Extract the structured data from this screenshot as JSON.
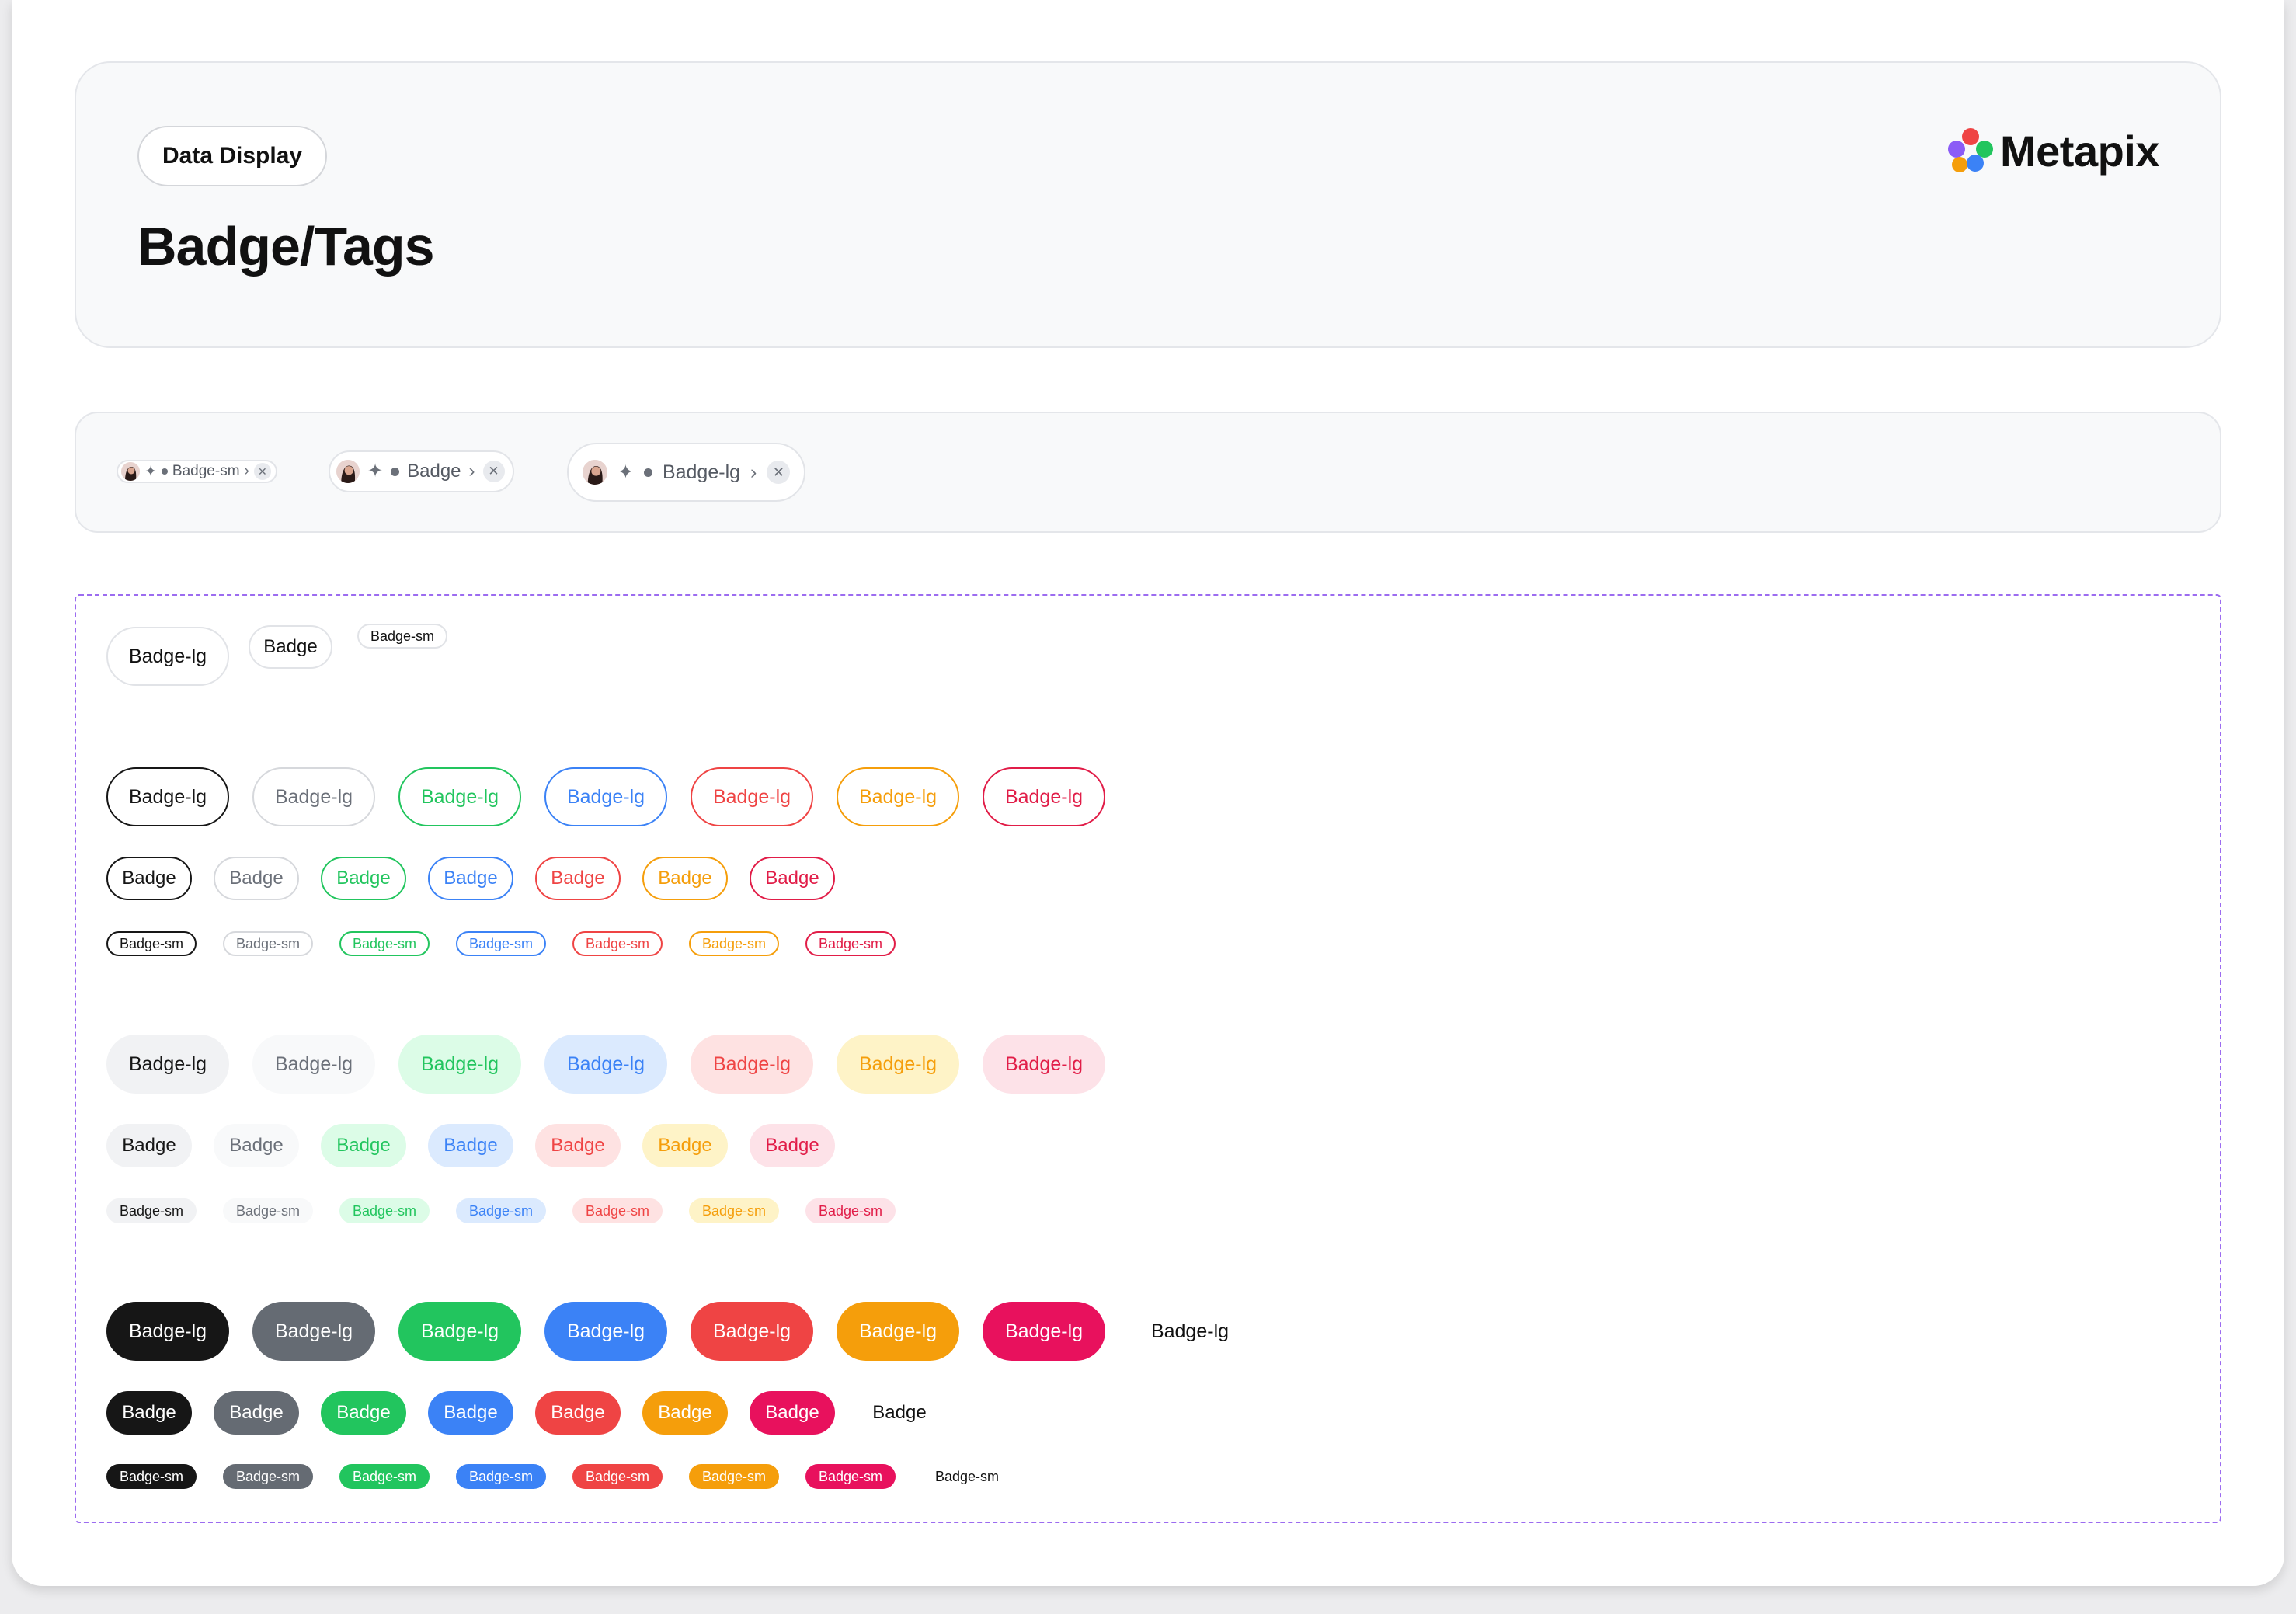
{
  "header": {
    "category": "Data Display",
    "title": "Badge/Tags",
    "brand": "Metapix",
    "logo_colors": [
      "#ef4444",
      "#8b5cf6",
      "#22c55e",
      "#3b82f6",
      "#f59e0b"
    ]
  },
  "preview_tags": [
    {
      "size": "sm",
      "label": "Badge-sm",
      "icons": [
        "avatar",
        "sparkle-icon",
        "dot-icon",
        "chevron-right-icon",
        "close-icon"
      ]
    },
    {
      "size": "md",
      "label": "Badge",
      "icons": [
        "avatar",
        "sparkle-icon",
        "dot-icon",
        "chevron-right-icon",
        "close-icon"
      ]
    },
    {
      "size": "lg",
      "label": "Badge-lg",
      "icons": [
        "avatar",
        "sparkle-icon",
        "dot-icon",
        "chevron-right-icon",
        "close-icon"
      ]
    }
  ],
  "basic_badges": [
    {
      "size": "lg",
      "label": "Badge-lg"
    },
    {
      "size": "md",
      "label": "Badge"
    },
    {
      "size": "sm",
      "label": "Badge-sm"
    }
  ],
  "palette": [
    {
      "name": "black",
      "main": "#161616",
      "text": "#161616",
      "border": "#161616",
      "light_bg": "#f1f2f4",
      "light_text": "#161616"
    },
    {
      "name": "gray",
      "main": "#656b73",
      "text": "#6b7079",
      "border": "#d6d8dc",
      "light_bg": "#f8f9fa",
      "light_text": "#6b7079"
    },
    {
      "name": "green",
      "main": "#22c55e",
      "text": "#22c55e",
      "border": "#22c55e",
      "light_bg": "#dcfce7",
      "light_text": "#22c55e"
    },
    {
      "name": "blue",
      "main": "#3b82f6",
      "text": "#3b82f6",
      "border": "#3b82f6",
      "light_bg": "#dbeafe",
      "light_text": "#3b82f6"
    },
    {
      "name": "red",
      "main": "#ef4444",
      "text": "#ef4444",
      "border": "#ef4444",
      "light_bg": "#fee2e2",
      "light_text": "#ef4444"
    },
    {
      "name": "amber",
      "main": "#f59e0b",
      "text": "#f59e0b",
      "border": "#f59e0b",
      "light_bg": "#fef3c7",
      "light_text": "#f59e0b"
    },
    {
      "name": "pink",
      "main": "#e8115d",
      "text": "#e11d48",
      "border": "#e11d48",
      "light_bg": "#fde2e8",
      "light_text": "#e11d48"
    }
  ],
  "variant_groups": [
    {
      "variant": "outline",
      "rows": [
        {
          "size": "lg",
          "label": "Badge-lg"
        },
        {
          "size": "md",
          "label": "Badge"
        },
        {
          "size": "sm",
          "label": "Badge-sm"
        }
      ]
    },
    {
      "variant": "soft",
      "rows": [
        {
          "size": "lg",
          "label": "Badge-lg"
        },
        {
          "size": "md",
          "label": "Badge"
        },
        {
          "size": "sm",
          "label": "Badge-sm"
        }
      ]
    },
    {
      "variant": "solid",
      "rows": [
        {
          "size": "lg",
          "label": "Badge-lg",
          "extra_plain_label": "Badge-lg"
        },
        {
          "size": "md",
          "label": "Badge",
          "extra_plain_label": "Badge"
        },
        {
          "size": "sm",
          "label": "Badge-sm",
          "extra_plain_label": "Badge-sm"
        }
      ]
    }
  ]
}
